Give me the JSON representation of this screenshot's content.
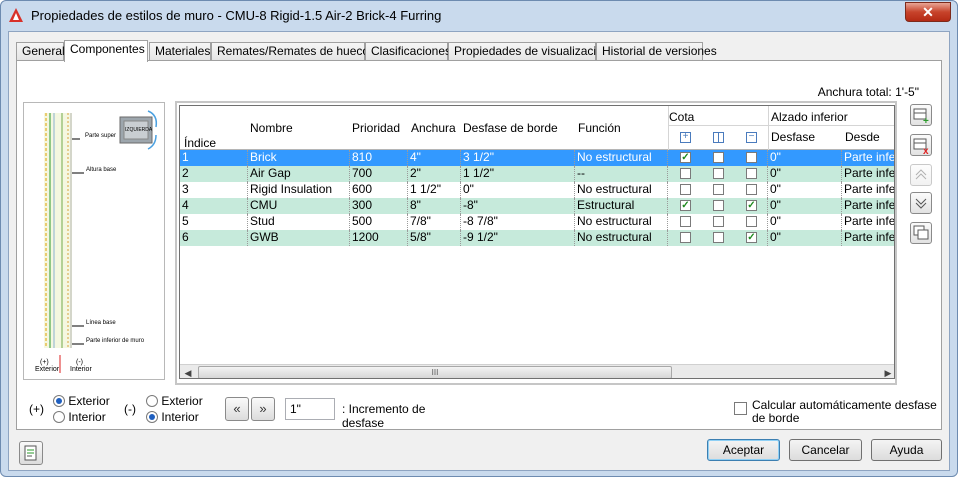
{
  "window": {
    "title": "Propiedades de estilos de muro - CMU-8 Rigid-1.5 Air-2 Brick-4 Furring",
    "close_label": "✕"
  },
  "tabs": [
    "General",
    "Componentes",
    "Materiales",
    "Remates/Remates de huecos",
    "Clasificaciones",
    "Propiedades de visualización",
    "Historial de versiones"
  ],
  "active_tab": "Componentes",
  "total_width": "Anchura total: 1'-5\"",
  "preview": {
    "labels": [
      "Parte super",
      "IZQUIERDA",
      "Altura base",
      "Línea base",
      "Parte inferior de muro",
      "(+)",
      "Exterior",
      "(-)",
      "Interior"
    ]
  },
  "grid": {
    "headers": {
      "index": "Índice",
      "name": "Nombre",
      "priority": "Prioridad",
      "width": "Anchura",
      "edge_offset": "Desfase de borde",
      "function": "Función",
      "dimension": "Cota",
      "bottom_elevation": "Alzado inferior",
      "offset": "Desfase",
      "from": "Desde"
    },
    "rows": [
      {
        "index": "1",
        "name": "Brick",
        "priority": "810",
        "width": "4\"",
        "edge_offset": "3 1/2\"",
        "function": "No estructural",
        "c1": true,
        "c2": false,
        "c3": false,
        "offset": "0\"",
        "from": "Parte inferior"
      },
      {
        "index": "2",
        "name": "Air Gap",
        "priority": "700",
        "width": "2\"",
        "edge_offset": "1 1/2\"",
        "function": "--",
        "c1": false,
        "c2": false,
        "c3": false,
        "offset": "0\"",
        "from": "Parte inferior"
      },
      {
        "index": "3",
        "name": "Rigid Insulation",
        "priority": "600",
        "width": "1 1/2\"",
        "edge_offset": "0\"",
        "function": "No estructural",
        "c1": false,
        "c2": false,
        "c3": false,
        "offset": "0\"",
        "from": "Parte inferior"
      },
      {
        "index": "4",
        "name": "CMU",
        "priority": "300",
        "width": "8\"",
        "edge_offset": "-8\"",
        "function": "Estructural",
        "c1": true,
        "c2": false,
        "c3": true,
        "offset": "0\"",
        "from": "Parte inferior"
      },
      {
        "index": "5",
        "name": "Stud",
        "priority": "500",
        "width": "7/8\"",
        "edge_offset": "-8 7/8\"",
        "function": "No estructural",
        "c1": false,
        "c2": false,
        "c3": false,
        "offset": "0\"",
        "from": "Parte inferior"
      },
      {
        "index": "6",
        "name": "GWB",
        "priority": "1200",
        "width": "5/8\"",
        "edge_offset": "-9 1/2\"",
        "function": "No estructural",
        "c1": false,
        "c2": false,
        "c3": true,
        "offset": "0\"",
        "from": "Parte inferior"
      }
    ],
    "scroll_thumb_grip": "III"
  },
  "plus_group": {
    "sign": "(+)",
    "options": [
      "Exterior",
      "Interior"
    ],
    "selected": 0
  },
  "minus_group": {
    "sign": "(-)",
    "options": [
      "Exterior",
      "Interior"
    ],
    "selected": 1
  },
  "increment": {
    "value": "1\"",
    "label_line1": ": Incremento de",
    "label_line2": "desfase"
  },
  "auto_calc": {
    "line1": "Calcular automáticamente desfase",
    "line2": "de borde",
    "checked": false
  },
  "buttons": {
    "accept": "Aceptar",
    "cancel": "Cancelar",
    "help": "Ayuda"
  },
  "colors": {
    "selection": "#3399ff",
    "alt_row": "#c6eadb",
    "check": "#1d8a1d"
  }
}
